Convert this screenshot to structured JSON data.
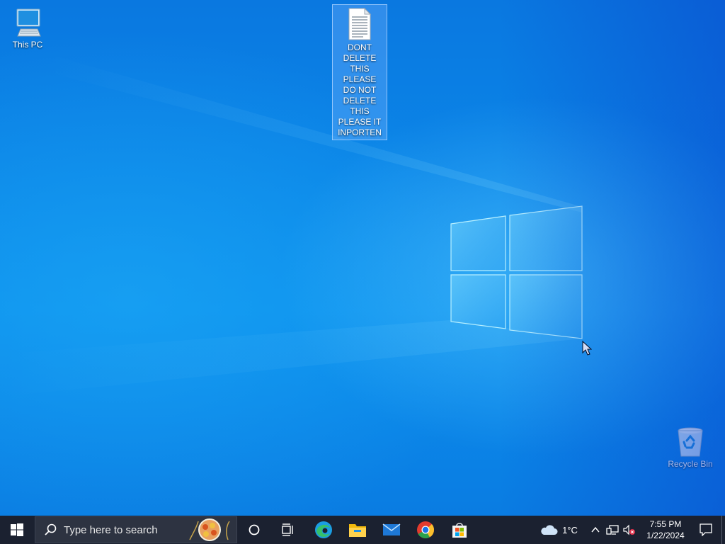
{
  "desktop": {
    "icons": [
      {
        "label": "This PC",
        "icon": "computer-monitor-icon"
      },
      {
        "label": "DONT DELETE THIS PLEASE DO NOT DELETE THIS PLEASE IT INPORTEN",
        "icon": "text-document-icon",
        "selected": true
      },
      {
        "label": "Recycle Bin",
        "icon": "recycle-bin-icon"
      }
    ]
  },
  "taskbar": {
    "search_placeholder": "Type here to search",
    "pinned_apps": [
      "Microsoft Edge",
      "File Explorer",
      "Mail",
      "Google Chrome",
      "Microsoft Store"
    ],
    "weather": {
      "temperature": "1°C",
      "icon": "cloud-icon"
    },
    "clock": {
      "time": "7:55 PM",
      "date": "1/22/2024"
    }
  },
  "colors": {
    "accent": "#0a78e0",
    "taskbar": "#1b2130"
  }
}
